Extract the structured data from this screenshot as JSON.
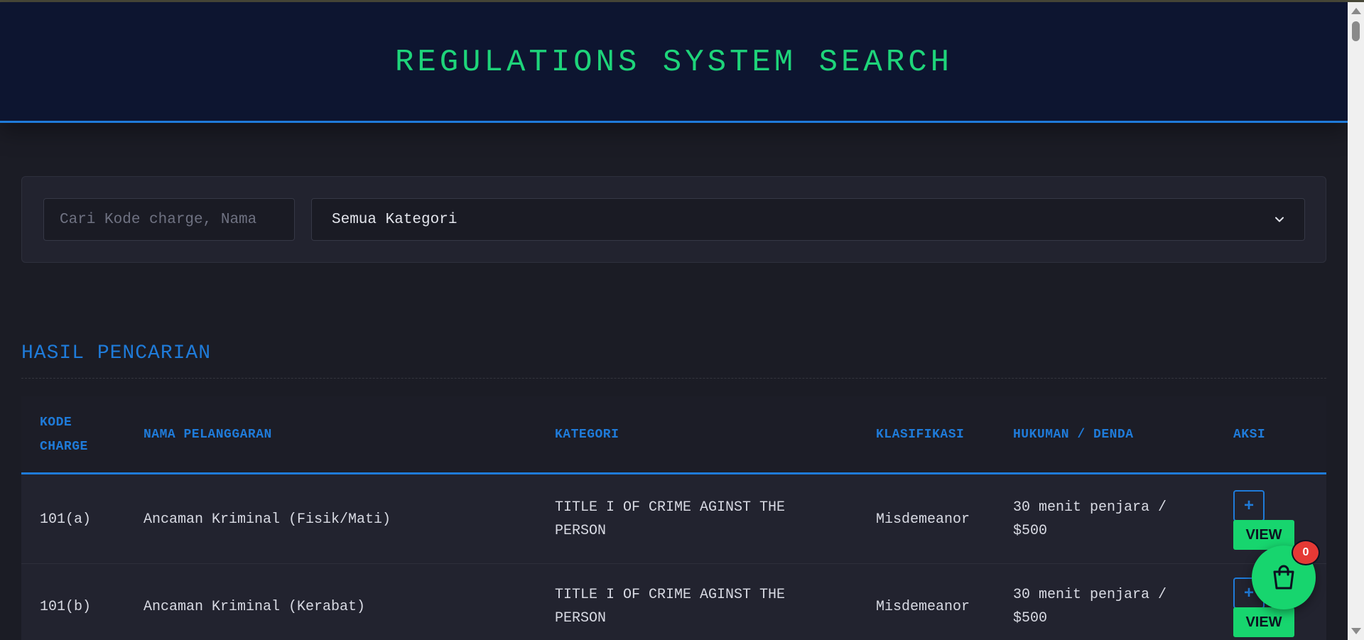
{
  "header": {
    "title": "REGULATIONS SYSTEM SEARCH"
  },
  "search": {
    "placeholder": "Cari Kode charge, Nama",
    "category_selected": "Semua Kategori"
  },
  "results": {
    "title": "HASIL PENCARIAN",
    "columns": {
      "kode": "KODE CHARGE",
      "nama": "NAMA PELANGGARAN",
      "kategori": "KATEGORI",
      "klasifikasi": "KLASIFIKASI",
      "hukuman": "HUKUMAN / DENDA",
      "aksi": "AKSI"
    },
    "rows": [
      {
        "kode": "101(a)",
        "nama": "Ancaman Kriminal (Fisik/Mati)",
        "kategori": "TITLE I OF CRIME AGINST THE PERSON",
        "klasifikasi": "Misdemeanor",
        "hukuman": "30 menit penjara / $500",
        "add_label": "+",
        "view_label": "VIEW"
      },
      {
        "kode": "101(b)",
        "nama": "Ancaman Kriminal (Kerabat)",
        "kategori": "TITLE I OF CRIME AGINST THE PERSON",
        "klasifikasi": "Misdemeanor",
        "hukuman": "30 menit penjara / $500",
        "add_label": "+",
        "view_label": "VIEW"
      }
    ]
  },
  "cart": {
    "count": "0",
    "icon": "shopping-bag-icon"
  },
  "colors": {
    "accent_green": "#1ed47a",
    "accent_blue": "#1f7bd9",
    "badge_red": "#e53935",
    "header_bg": "#0d1530",
    "page_bg": "#1b1c25"
  }
}
